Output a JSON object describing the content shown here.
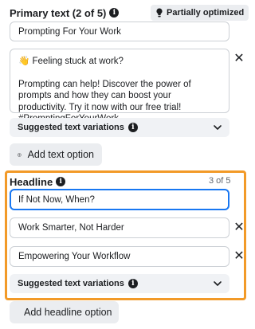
{
  "primary_text": {
    "title": "Primary text (2 of 5)",
    "badge": "Partially optimized",
    "input_1_value": "Prompting For Your Work",
    "textarea_line_1": "👋 Feeling stuck at work?",
    "textarea_line_2": "Prompting can help! Discover the power of prompts and how they can boost your productivity. Try it now with our free trial! #PromptingForYourWork",
    "suggestions_label": "Suggested text variations",
    "add_button": "Add text option"
  },
  "headline": {
    "title": "Headline",
    "counter": "3 of 5",
    "input_1_value": "If Not Now, When?",
    "input_2_value": "Work Smarter, Not Harder",
    "input_3_value": "Empowering Your Workflow",
    "suggestions_label": "Suggested text variations",
    "add_button": "Add headline option"
  },
  "icons": {
    "info": "info-icon",
    "bulb": "lightbulb-icon",
    "close": "close-icon",
    "chevron": "chevron-down-icon",
    "plus": "plus-circle-icon"
  },
  "colors": {
    "highlight": "#f29a28",
    "focus": "#1877f2",
    "muted_bg": "#f0f2f5"
  }
}
